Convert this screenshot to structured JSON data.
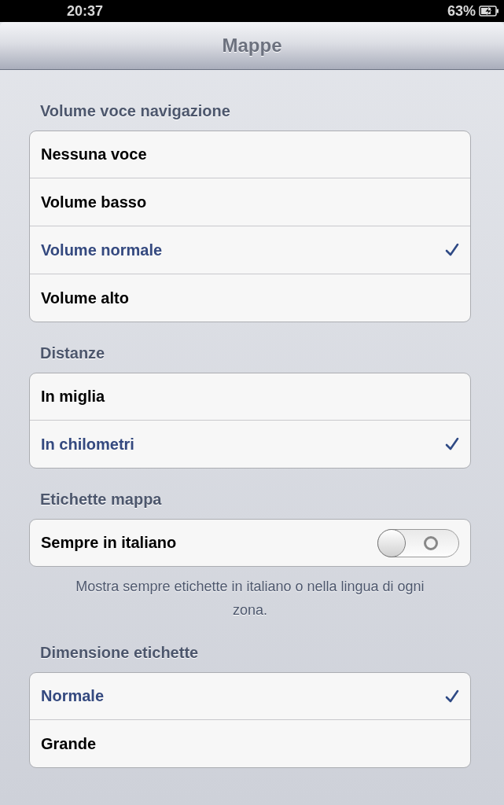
{
  "status_bar": {
    "time": "20:37",
    "battery_text": "63%"
  },
  "nav_bar": {
    "title": "Mappe"
  },
  "sections": [
    {
      "header": "Volume voce navigazione",
      "rows": [
        {
          "kind": "option",
          "label": "Nessuna voce",
          "selected": false
        },
        {
          "kind": "option",
          "label": "Volume basso",
          "selected": false
        },
        {
          "kind": "option",
          "label": "Volume normale",
          "selected": true
        },
        {
          "kind": "option",
          "label": "Volume alto",
          "selected": false
        }
      ]
    },
    {
      "header": "Distanze",
      "rows": [
        {
          "kind": "option",
          "label": "In miglia",
          "selected": false
        },
        {
          "kind": "option",
          "label": "In chilometri",
          "selected": true
        }
      ]
    },
    {
      "header": "Etichette mappa",
      "rows": [
        {
          "kind": "toggle",
          "label": "Sempre in italiano",
          "on": false
        }
      ],
      "footer": "Mostra sempre etichette in italiano o nella lingua di ogni zona."
    },
    {
      "header": "Dimensione etichette",
      "rows": [
        {
          "kind": "option",
          "label": "Normale",
          "selected": true
        },
        {
          "kind": "option",
          "label": "Grande",
          "selected": false
        }
      ]
    }
  ]
}
